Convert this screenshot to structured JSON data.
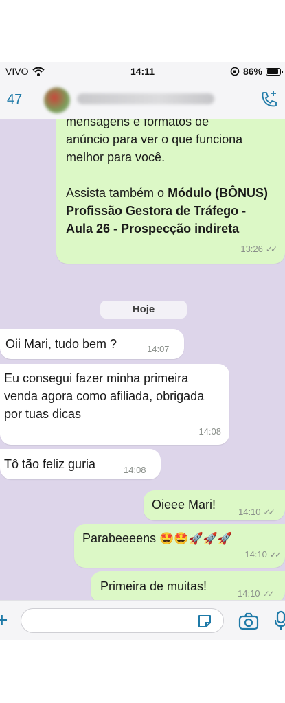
{
  "status_bar": {
    "carrier": "VIVO",
    "time": "14:11",
    "battery": "86%"
  },
  "header": {
    "back_count": "47"
  },
  "messages": [
    {
      "id": "m1",
      "direction": "out",
      "lines": [
        "mensagens e formatos de",
        "anúncio para ver o que funciona",
        "melhor para você."
      ],
      "lines2_prefix": "Assista também o ",
      "lines2_bold": "Módulo (BÔNUS) Profissão Gestora de Tráfego - Aula 26 - Prospecção indireta",
      "time": "13:26"
    },
    {
      "id": "m2",
      "direction": "in",
      "text": "Oii Mari, tudo bem ?",
      "time": "14:07"
    },
    {
      "id": "m3",
      "direction": "in",
      "text": "Eu consegui fazer minha primeira venda agora como afiliada, obrigada por tuas dicas",
      "time": "14:08"
    },
    {
      "id": "m4",
      "direction": "in",
      "text": "Tô tão feliz guria",
      "time": "14:08"
    },
    {
      "id": "m5",
      "direction": "out",
      "text": "Oieee Mari!",
      "time": "14:10"
    },
    {
      "id": "m6",
      "direction": "out",
      "text": "Parabeeeens",
      "emojis": "🤩🤩🚀🚀🚀",
      "time": "14:10"
    },
    {
      "id": "m7",
      "direction": "out",
      "text": "Primeira de muitas!",
      "time": "14:10"
    }
  ],
  "date_divider": "Hoje",
  "colors": {
    "outgoing": "#dcf8c6",
    "incoming": "#ffffff",
    "wallpaper": "#ddd5ea",
    "accent": "#1f7aa8"
  }
}
